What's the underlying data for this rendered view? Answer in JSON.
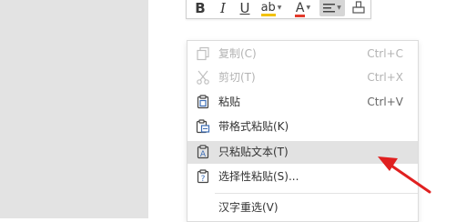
{
  "toolbar": {
    "bold": "B",
    "italic": "I",
    "underline": "U",
    "highlight": "ab",
    "font_color": "A",
    "highlight_color": "#f2c200",
    "font_color_bar": "#e33a2b"
  },
  "menu": {
    "copy": {
      "label": "复制(C)",
      "shortcut": "Ctrl+C"
    },
    "cut": {
      "label": "剪切(T)",
      "shortcut": "Ctrl+X"
    },
    "paste": {
      "label": "粘贴",
      "shortcut": "Ctrl+V"
    },
    "paste_format": {
      "label": "带格式粘贴(K)"
    },
    "paste_text": {
      "label": "只粘贴文本(T)"
    },
    "paste_special": {
      "label": "选择性粘贴(S)..."
    },
    "reconvert": {
      "label": "汉字重选(V)"
    }
  },
  "colors": {
    "arrow": "#e02020",
    "icon": "#3d6db5"
  }
}
